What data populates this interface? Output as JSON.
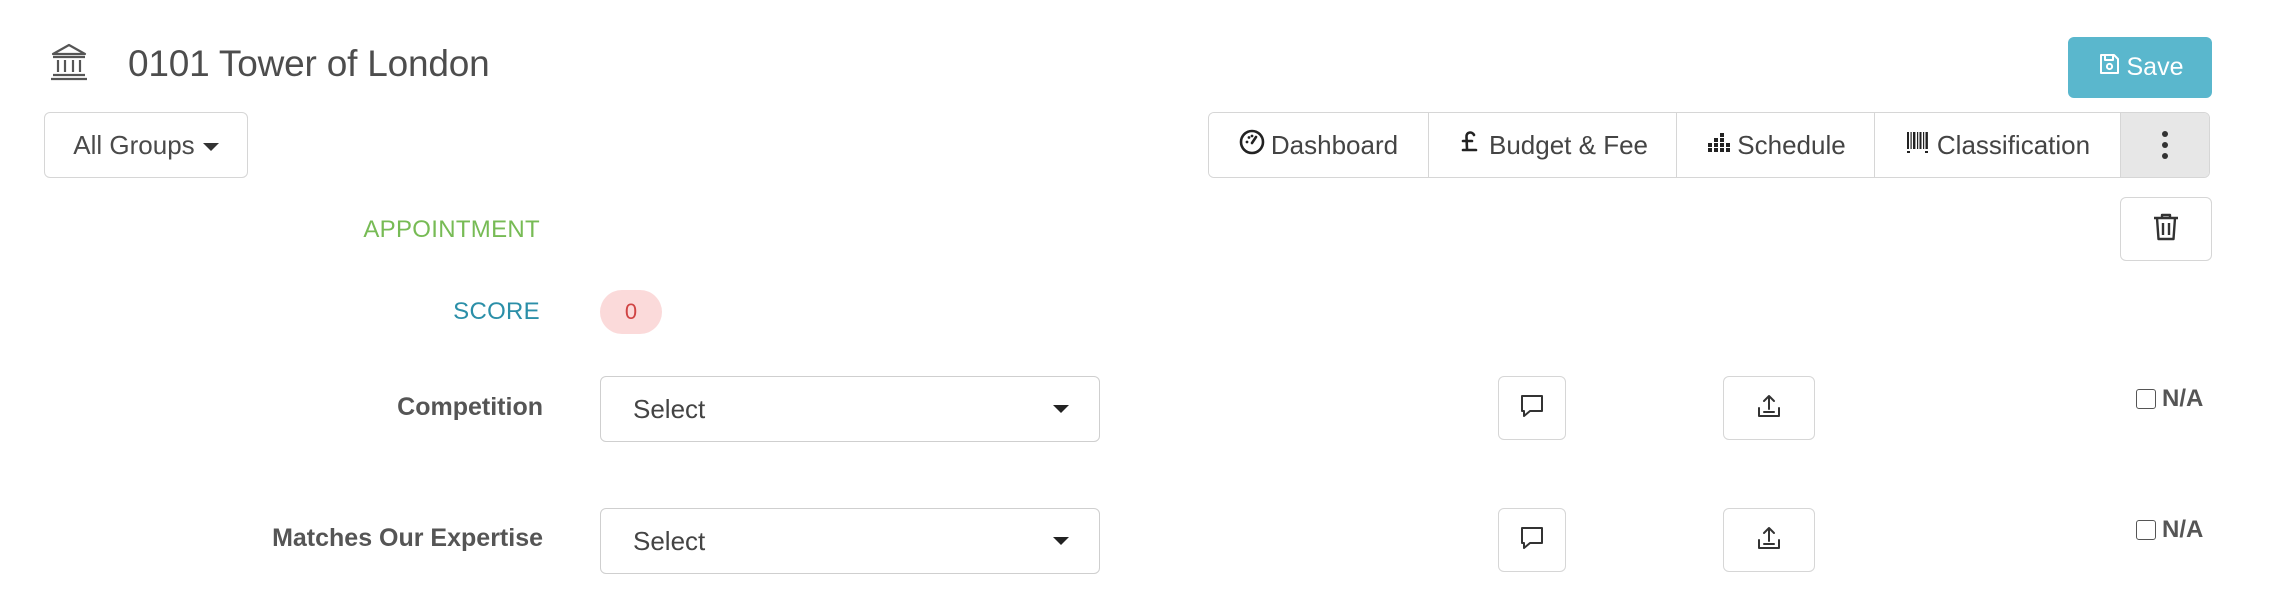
{
  "header": {
    "title": "0101 Tower of London",
    "icon": "building-columns-icon",
    "save_label": "Save"
  },
  "groups": {
    "label": "All Groups"
  },
  "tabs": [
    {
      "label": "Dashboard",
      "icon": "gauge-icon"
    },
    {
      "label": "Budget & Fee",
      "icon": "pound-icon"
    },
    {
      "label": "Schedule",
      "icon": "bar-dots-icon"
    },
    {
      "label": "Classification",
      "icon": "barcode-icon"
    }
  ],
  "section": {
    "appointment": "APPOINTMENT",
    "score_label": "SCORE",
    "score_value": "0"
  },
  "rows": [
    {
      "label": "Competition",
      "select_value": "Select",
      "na_label": "N/A"
    },
    {
      "label": "Matches Our Expertise",
      "select_value": "Select",
      "na_label": "N/A"
    }
  ],
  "colors": {
    "save": "#5ab7cd",
    "appointment": "#77bb55",
    "score_label": "#2b8fa8",
    "score_badge_bg": "#fbdada",
    "score_badge_text": "#d04444"
  }
}
